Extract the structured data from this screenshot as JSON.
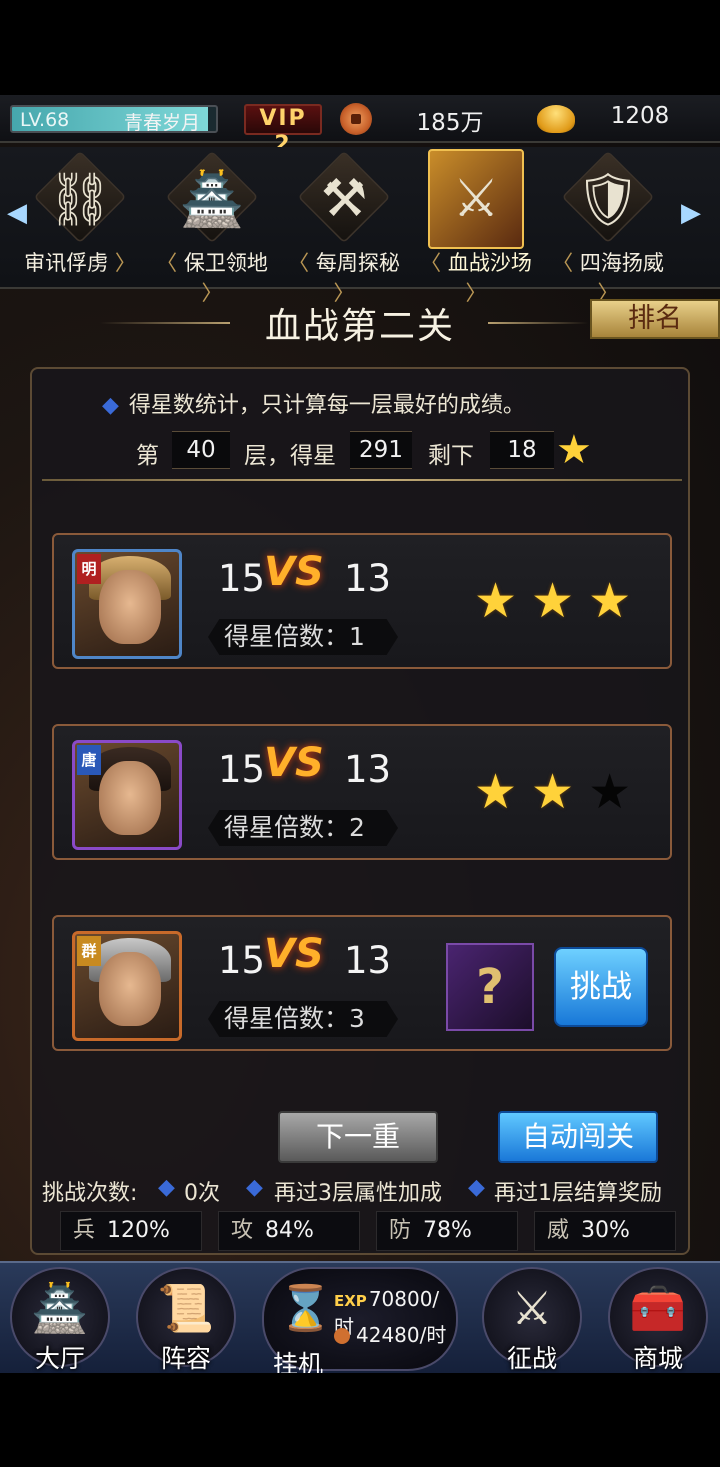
{
  "status": {
    "level": "LV.68",
    "level_progress": 0.96,
    "player_name": "青春岁月",
    "vip": "VIP 2",
    "coins": "185万",
    "gold": "1208"
  },
  "modes": [
    {
      "label": "审讯俘虏",
      "icon": "torture-rack-icon",
      "glyph": "⚙"
    },
    {
      "label": "保卫领地",
      "icon": "pagoda-icon",
      "glyph": "🏯"
    },
    {
      "label": "每周探秘",
      "icon": "treasure-icon",
      "glyph": "⚒"
    },
    {
      "label": "血战沙场",
      "icon": "general-icon",
      "glyph": "⚔",
      "active": true
    },
    {
      "label": "四海扬威",
      "icon": "crossed-swords-shield-icon",
      "glyph": "🛡"
    }
  ],
  "title": "血战第二关",
  "rank_button": "排名",
  "rule_text": "得星数统计，只计算每一层最好的成绩。",
  "floor": {
    "prefix": "第",
    "floor_value": "40",
    "middle": "层，得星",
    "stars_value": "291",
    "remain_label": "剩下",
    "remain_value": "18"
  },
  "battles": [
    {
      "faction": "明",
      "ours": "15",
      "vs": "VS",
      "theirs": "13",
      "mult_label": "得星倍数：",
      "mult": "1",
      "stars": [
        1,
        1,
        1
      ]
    },
    {
      "faction": "唐",
      "ours": "15",
      "vs": "VS",
      "theirs": "13",
      "mult_label": "得星倍数：",
      "mult": "2",
      "stars": [
        1,
        1,
        0
      ]
    },
    {
      "faction": "群",
      "ours": "15",
      "vs": "VS",
      "theirs": "13",
      "mult_label": "得星倍数：",
      "mult": "3",
      "mystery": "?",
      "challenge": "挑战"
    }
  ],
  "next_button": "下一重",
  "auto_button": "自动闯关",
  "info": {
    "attempts_label": "挑战次数:",
    "attempts_value": "0次",
    "bonus1": "再过3层属性加成",
    "bonus2": "再过1层结算奖励"
  },
  "stats": [
    {
      "k": "兵",
      "v": "120%"
    },
    {
      "k": "攻",
      "v": "84%"
    },
    {
      "k": "防",
      "v": "78%"
    },
    {
      "k": "威",
      "v": "30%"
    }
  ],
  "nav": {
    "hall": "大厅",
    "lineup": "阵容",
    "idle": "挂机",
    "exp_rate": "70800/时",
    "coin_rate": "42480/时",
    "campaign": "征战",
    "shop": "商城"
  },
  "colors": {
    "accent_gold": "#ffd23a",
    "panel_border": "#8a5a3a",
    "button_blue": "#1a78d8"
  }
}
